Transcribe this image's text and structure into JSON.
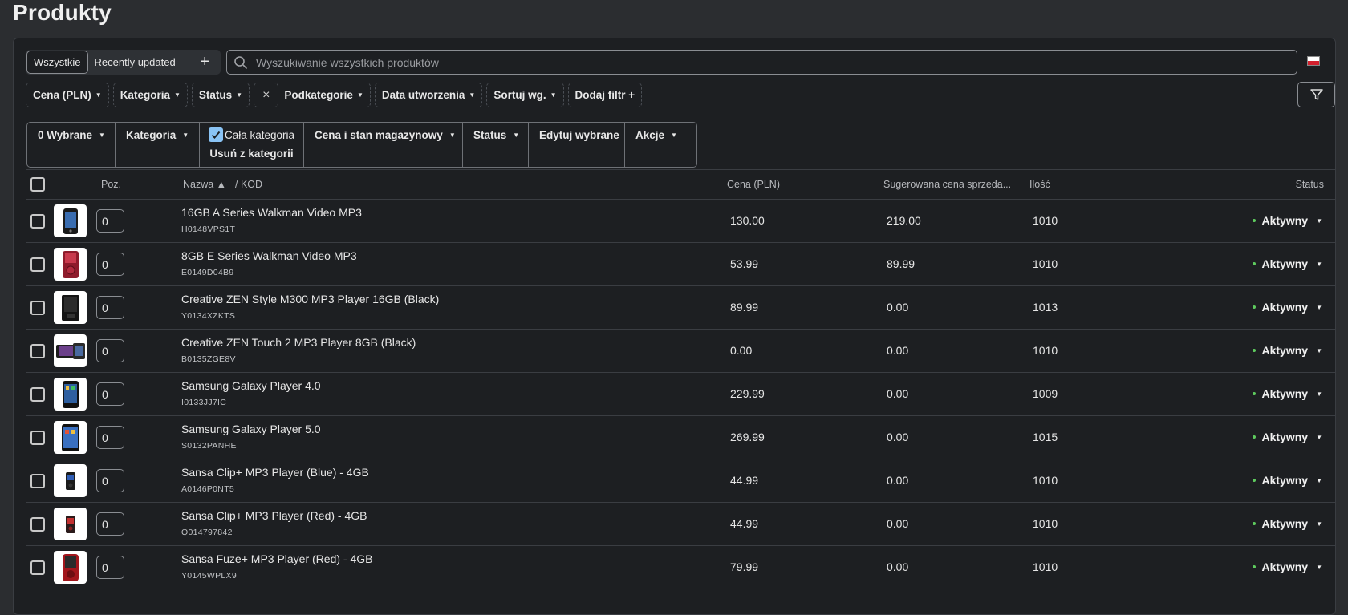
{
  "page_title": "Produkty",
  "views": {
    "all": "Wszystkie",
    "recent": "Recently updated",
    "add": "+"
  },
  "search": {
    "placeholder": "Wyszukiwanie wszystkich produktów",
    "value": ""
  },
  "filters": {
    "price": "Cena (PLN)",
    "category": "Kategoria",
    "status": "Status",
    "clear": "×",
    "subcategories": "Podkategorie",
    "created": "Data utworzenia",
    "sort": "Sortuj wg.",
    "add_filter": "Dodaj filtr +"
  },
  "bulk": {
    "selected": "0 Wybrane",
    "category": "Kategoria",
    "whole_category": "Cała kategoria",
    "remove_from_category": "Usuń z kategorii",
    "price_stock": "Cena i stan magazynowy",
    "status": "Status",
    "edit_selected": "Edytuj wybrane",
    "actions": "Akcje"
  },
  "columns": {
    "position": "Poz.",
    "name": "Nazwa ▲",
    "code": "/  KOD",
    "price": "Cena (PLN)",
    "suggested_price": "Sugerowana cena sprzeda...",
    "quantity": "Ilość",
    "status": "Status"
  },
  "products": [
    {
      "name": "16GB A Series Walkman Video MP3",
      "sku": "H0148VPS1T",
      "pos": "0",
      "price": "130.00",
      "suggested": "219.00",
      "qty": "1010",
      "status": "Aktywny"
    },
    {
      "name": "8GB E Series Walkman Video MP3",
      "sku": "E0149D04B9",
      "pos": "0",
      "price": "53.99",
      "suggested": "89.99",
      "qty": "1010",
      "status": "Aktywny"
    },
    {
      "name": "Creative ZEN Style M300 MP3 Player 16GB (Black)",
      "sku": "Y0134XZKTS",
      "pos": "0",
      "price": "89.99",
      "suggested": "0.00",
      "qty": "1013",
      "status": "Aktywny"
    },
    {
      "name": "Creative ZEN Touch 2 MP3 Player 8GB (Black)",
      "sku": "B0135ZGE8V",
      "pos": "0",
      "price": "0.00",
      "suggested": "0.00",
      "qty": "1010",
      "status": "Aktywny"
    },
    {
      "name": "Samsung Galaxy Player 4.0",
      "sku": "I0133JJ7IC",
      "pos": "0",
      "price": "229.99",
      "suggested": "0.00",
      "qty": "1009",
      "status": "Aktywny"
    },
    {
      "name": "Samsung Galaxy Player 5.0",
      "sku": "S0132PANHE",
      "pos": "0",
      "price": "269.99",
      "suggested": "0.00",
      "qty": "1015",
      "status": "Aktywny"
    },
    {
      "name": "Sansa Clip+ MP3 Player (Blue) - 4GB",
      "sku": "A0146P0NT5",
      "pos": "0",
      "price": "44.99",
      "suggested": "0.00",
      "qty": "1010",
      "status": "Aktywny"
    },
    {
      "name": "Sansa Clip+ MP3 Player (Red) - 4GB",
      "sku": "Q014797842",
      "pos": "0",
      "price": "44.99",
      "suggested": "0.00",
      "qty": "1010",
      "status": "Aktywny"
    },
    {
      "name": "Sansa Fuze+ MP3 Player (Red) - 4GB",
      "sku": "Y0145WPLX9",
      "pos": "0",
      "price": "79.99",
      "suggested": "0.00",
      "qty": "1010",
      "status": "Aktywny"
    }
  ],
  "colors": {
    "background": "#2b2d30",
    "panel": "#1d1f22",
    "active_dot": "#5ecb5e",
    "checkbox_checked": "#8ac4f5"
  },
  "icons": {
    "search": "search-icon",
    "filter": "funnel-icon",
    "flag": "poland-flag-icon"
  }
}
